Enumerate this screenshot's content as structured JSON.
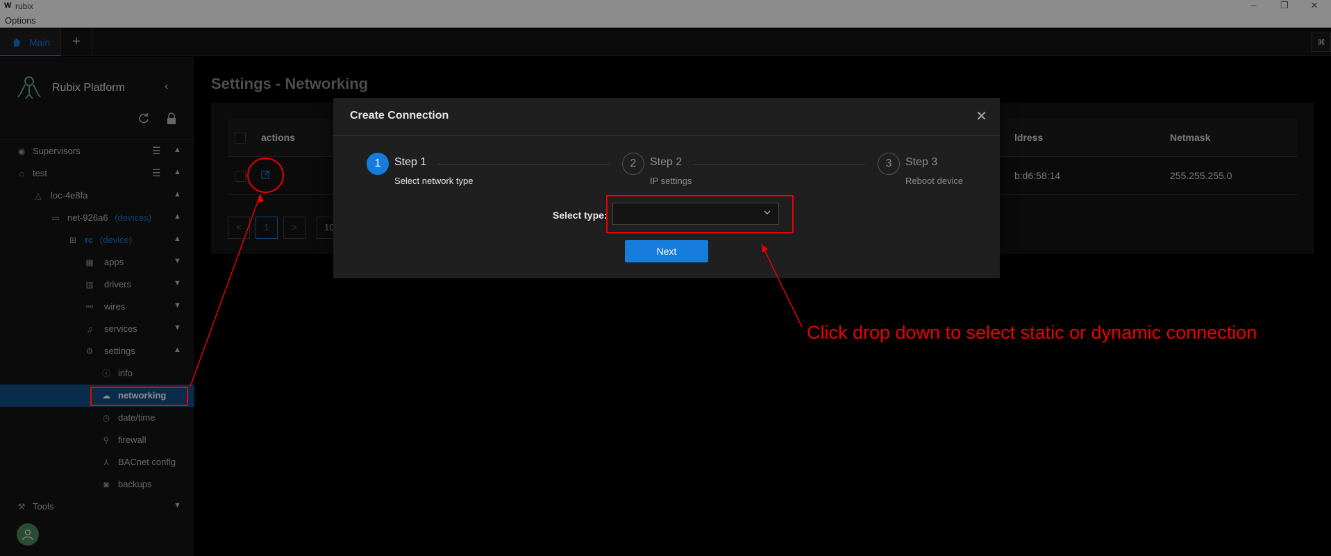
{
  "window": {
    "app_letter": "W",
    "title": "rubix",
    "minimize": "–",
    "restore": "❐",
    "close": "✕"
  },
  "menu": {
    "options": "Options"
  },
  "tabs": {
    "main_label": "Main",
    "add": "+",
    "right_btn": "⌘"
  },
  "sidebar": {
    "brand": "Rubix Platform",
    "collapse": "‹",
    "refresh": "⟳",
    "lock": "🔒",
    "items": [
      {
        "label": "Supervisors",
        "icon": "eye-icon"
      },
      {
        "label": "test",
        "icon": "home-icon"
      },
      {
        "label": "loc-4e8fa",
        "icon": "warning-icon"
      },
      {
        "label": "net-926a6",
        "sub": "(devices)",
        "icon": "laptop-icon"
      },
      {
        "label": "rc",
        "sub": "(device)",
        "icon": "network-icon"
      },
      {
        "label": "apps",
        "icon": "apps-icon"
      },
      {
        "label": "drivers",
        "icon": "drivers-icon"
      },
      {
        "label": "wires",
        "icon": "wires-icon"
      },
      {
        "label": "services",
        "icon": "bell-icon"
      },
      {
        "label": "settings",
        "icon": "gear-icon"
      },
      {
        "label": "info",
        "icon": "info-icon"
      },
      {
        "label": "networking",
        "icon": "cloud-icon"
      },
      {
        "label": "date/time",
        "icon": "clock-icon"
      },
      {
        "label": "firewall",
        "icon": "link-icon"
      },
      {
        "label": "BACnet config",
        "icon": "cluster-icon"
      },
      {
        "label": "backups",
        "icon": "camera-icon"
      },
      {
        "label": "Tools",
        "icon": "tool-icon"
      }
    ]
  },
  "page": {
    "title": "Settings - Networking"
  },
  "table": {
    "headers": {
      "actions": "actions",
      "address": "ldress",
      "netmask": "Netmask"
    },
    "row": {
      "address": "b:d6:58:14",
      "netmask": "255.255.255.0"
    },
    "pagination": {
      "prev": "<",
      "page": "1",
      "next": ">",
      "size": "10"
    }
  },
  "modal": {
    "title": "Create Connection",
    "close": "✕",
    "steps": [
      {
        "num": "1",
        "title": "Step 1",
        "desc": "Select network type"
      },
      {
        "num": "2",
        "title": "Step 2",
        "desc": "IP settings"
      },
      {
        "num": "3",
        "title": "Step 3",
        "desc": "Reboot device"
      }
    ],
    "select_label": "Select type:",
    "select_value": "",
    "next": "Next"
  },
  "annotation": {
    "text": "Click drop down to select static or dynamic connection",
    "color": "#ee0000"
  },
  "colors": {
    "accent": "#177ddc",
    "active_menu": "#11508a"
  }
}
